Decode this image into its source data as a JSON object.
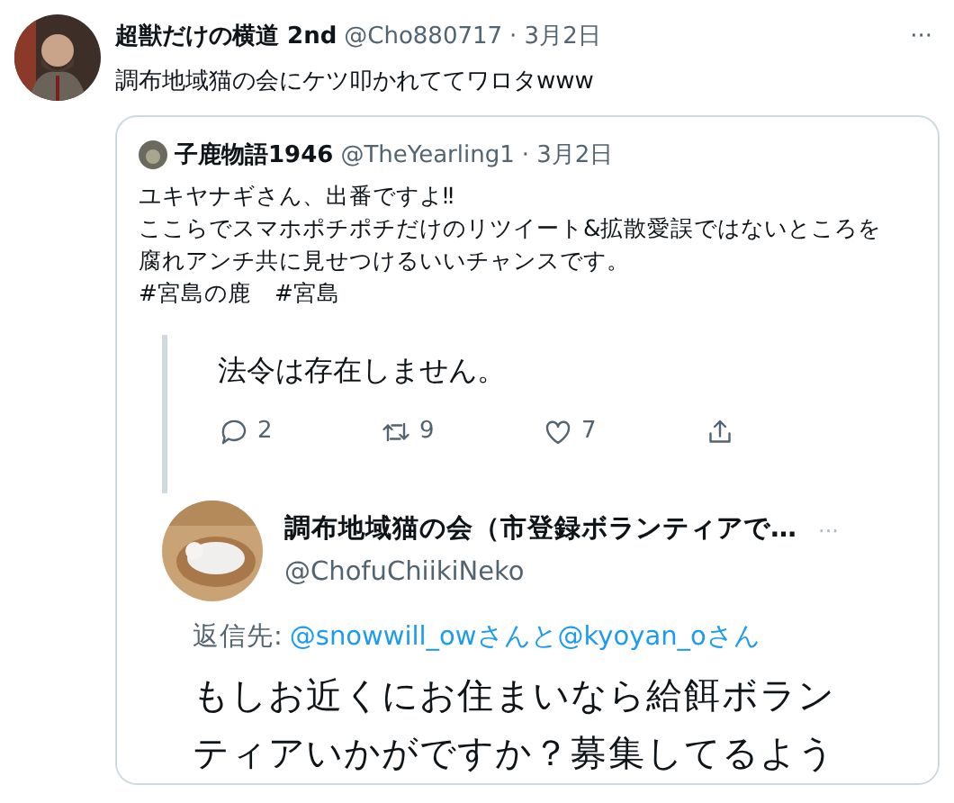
{
  "tweet": {
    "name": "超獣だけの横道 2nd",
    "handle": "@Cho880717",
    "date": "· 3月2日",
    "more": "···",
    "text": "調布地域猫の会にケツ叩かれててワロタwww"
  },
  "quote": {
    "name": "子鹿物語1946",
    "handle": "@TheYearling1",
    "date": "· 3月2日",
    "lines": [
      "ユキヤナギさん、出番ですよ‼",
      "ここらでスマホポチポチだけのリツイート&拡散愛誤ではないところを",
      "腐れアンチ共に見せつけるいいチャンスです。",
      "#宮島の鹿　#宮島"
    ]
  },
  "screenshot": {
    "parent_text": "法令は存在しません。",
    "actions": [
      {
        "kind": "reply",
        "count": "2"
      },
      {
        "kind": "retweet",
        "count": "9"
      },
      {
        "kind": "like",
        "count": "7"
      },
      {
        "kind": "share"
      }
    ],
    "reply": {
      "name": "調布地域猫の会（市登録ボランティアで…",
      "more": "···",
      "handle": "@ChofuChiikiNeko",
      "reply_to_label": "返信先:",
      "reply_to": "@snowwill_owさんと@kyoyan_oさん",
      "lines": [
        "もしお近くにお住まいなら給餌ボラン",
        "ティアいかがですか？募集してるよう"
      ]
    }
  }
}
